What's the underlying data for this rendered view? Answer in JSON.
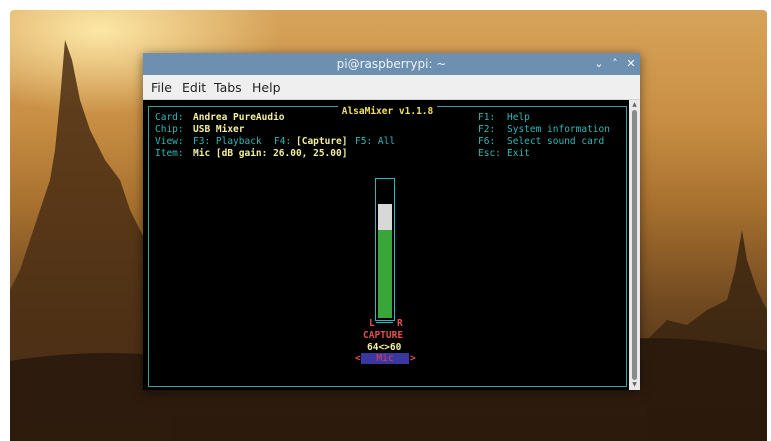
{
  "window": {
    "title": "pi@raspberrypi: ~",
    "buttons": {
      "minimize": "⌄",
      "maximize": "˄",
      "close": "✕"
    }
  },
  "menubar": {
    "items": [
      "File",
      "Edit",
      "Tabs",
      "Help"
    ]
  },
  "alsamixer": {
    "title": "AlsaMixer v1.1.8",
    "card_label": "Card:",
    "card_value": "Andrea PureAudio",
    "chip_label": "Chip:",
    "chip_value": "USB Mixer",
    "view_label": "View:",
    "view_f3": "F3: Playback",
    "view_f4_key": "F4:",
    "view_f4_value": "[Capture]",
    "view_f5": "F5: All",
    "item_label": "Item:",
    "item_value": "Mic [dB gain: 26.00, 25.00]",
    "help_keys": [
      {
        "key": "F1:",
        "text": "Help"
      },
      {
        "key": "F2:",
        "text": "System information"
      },
      {
        "key": "F6:",
        "text": "Select sound card"
      },
      {
        "key": "Esc:",
        "text": "Exit"
      }
    ],
    "control": {
      "left_label": "L",
      "right_label": "R",
      "capture_label": "CAPTURE",
      "values": "64<>60",
      "name": "Mic",
      "left_arrow": "<",
      "right_arrow": ">",
      "level_fraction": 0.64,
      "peak_fraction": 0.83
    }
  },
  "colors": {
    "label_cyan": "#2fb8b8",
    "value_yellow": "#f2f0a0",
    "meter_green": "#3aa63a",
    "capture_red": "#e05050",
    "selected_bg": "#3a38a0",
    "titlebar": "#6d8fb0"
  }
}
